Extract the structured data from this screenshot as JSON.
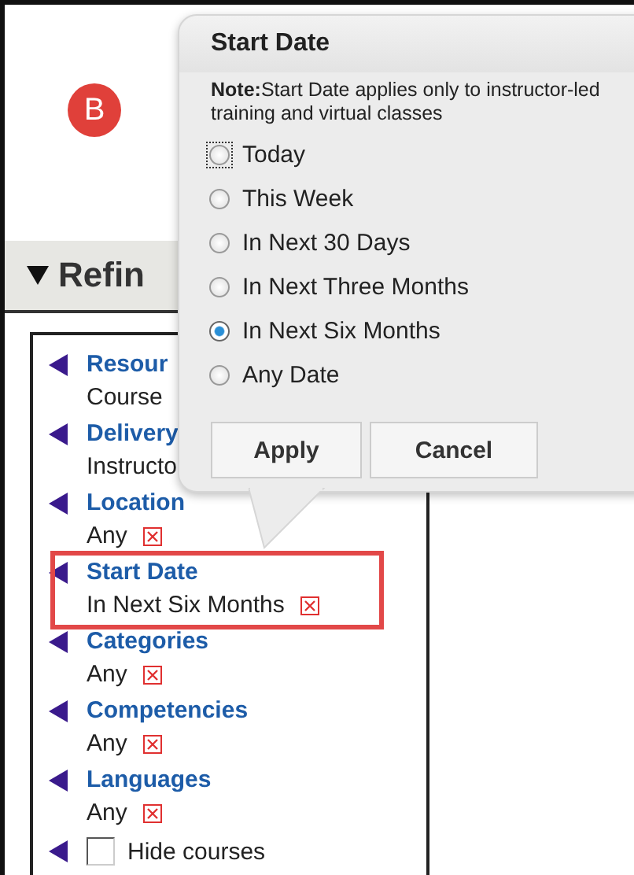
{
  "badge": "B",
  "refine": {
    "label": "Refin",
    "expanded": true
  },
  "filters": [
    {
      "kind": "filter",
      "title": "Resour",
      "value": "Course",
      "highlighted": false
    },
    {
      "kind": "filter",
      "title": "Delivery",
      "value": "Instructo",
      "highlighted": false
    },
    {
      "kind": "filter",
      "title": "Location",
      "value": "Any",
      "removable": true,
      "highlighted": false
    },
    {
      "kind": "filter",
      "title": "Start Date",
      "value": "In Next Six Months",
      "removable": true,
      "highlighted": true
    },
    {
      "kind": "filter",
      "title": "Categories",
      "value": "Any",
      "removable": true,
      "highlighted": false
    },
    {
      "kind": "filter",
      "title": "Competencies",
      "value": "Any",
      "removable": true,
      "highlighted": false
    },
    {
      "kind": "filter",
      "title": "Languages",
      "value": "Any",
      "removable": true,
      "highlighted": false
    },
    {
      "kind": "checkbox",
      "label": "Hide courses",
      "checked": false
    }
  ],
  "popup": {
    "title": "Start Date",
    "note": "**Note:**Start Date applies only to instructor-led training and virtual classes",
    "options": [
      {
        "label": "Today",
        "selected": false,
        "focused": true
      },
      {
        "label": "This Week",
        "selected": false,
        "focused": false
      },
      {
        "label": "In Next 30 Days",
        "selected": false,
        "focused": false
      },
      {
        "label": "In Next Three Months",
        "selected": false,
        "focused": false
      },
      {
        "label": "In Next Six Months",
        "selected": true,
        "focused": false
      },
      {
        "label": "Any Date",
        "selected": false,
        "focused": false
      }
    ],
    "buttons": [
      "Apply",
      "Cancel"
    ]
  }
}
